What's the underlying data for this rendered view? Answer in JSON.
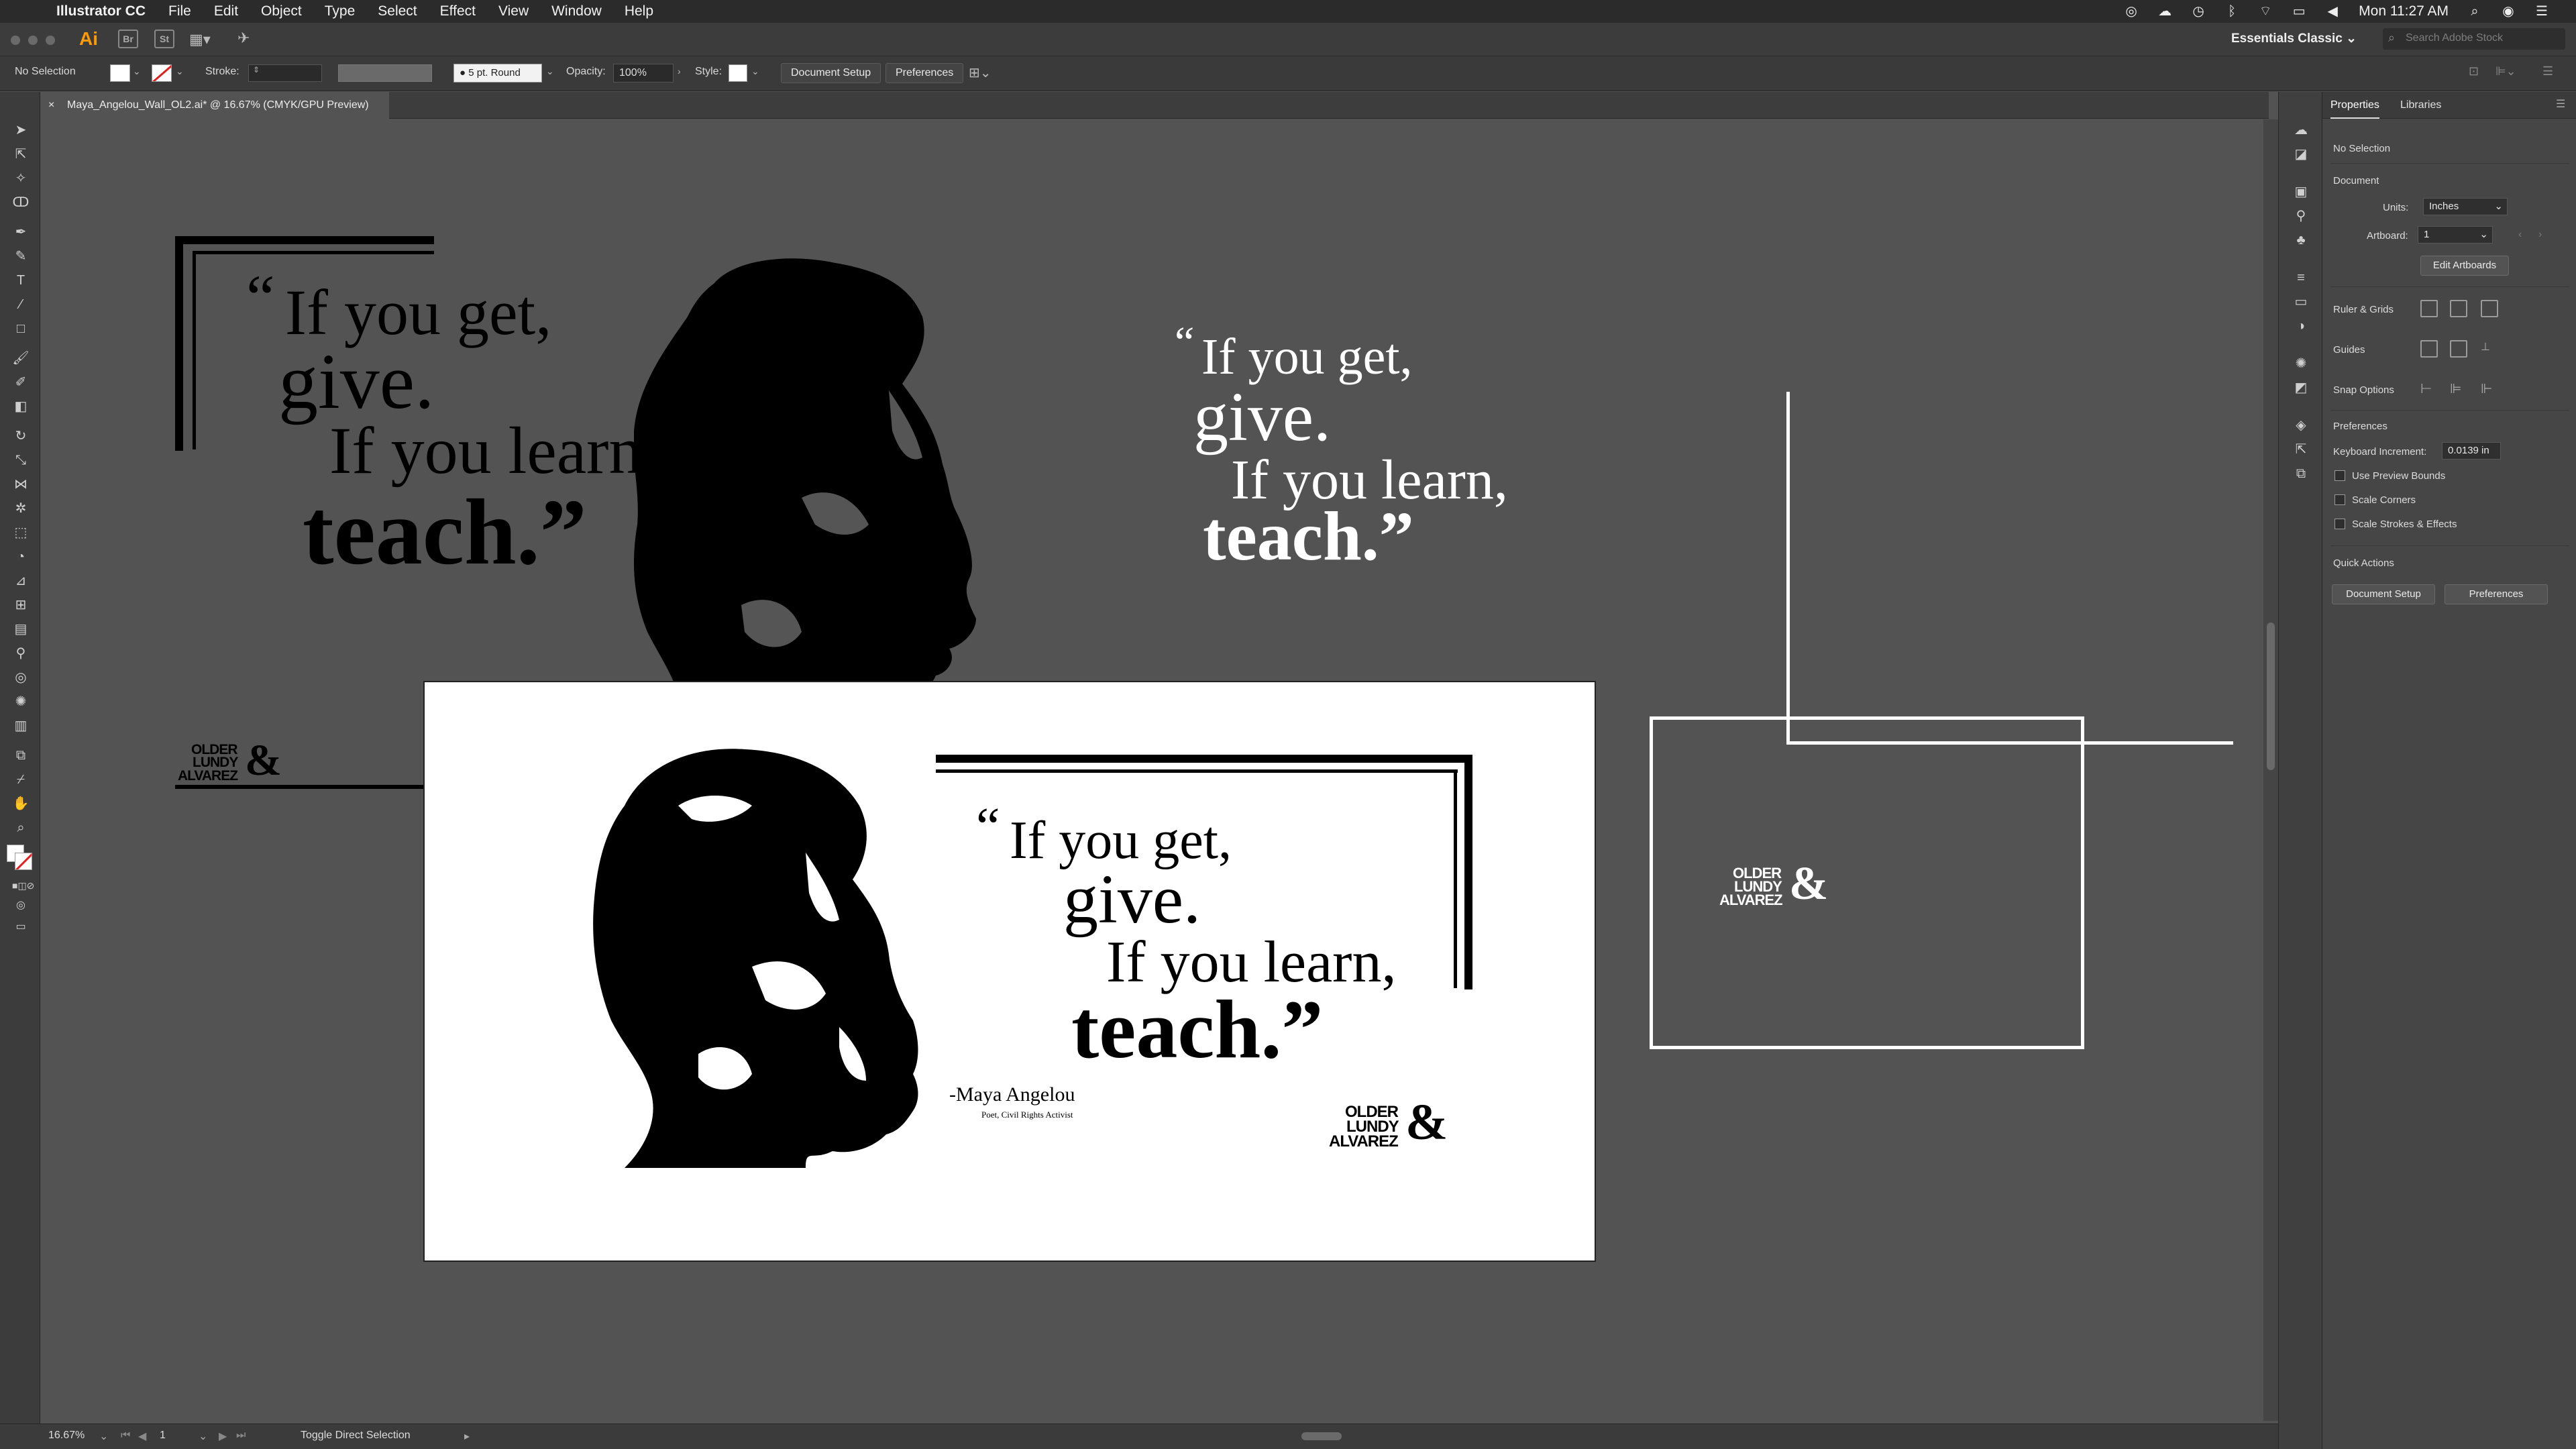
{
  "menubar": {
    "app_name": "Illustrator CC",
    "menus": [
      "File",
      "Edit",
      "Object",
      "Type",
      "Select",
      "Effect",
      "View",
      "Window",
      "Help"
    ],
    "clock": "Mon 11:27 AM"
  },
  "appbar": {
    "ai_logo": "Ai",
    "workspace": "Essentials Classic",
    "search_placeholder": "Search Adobe Stock"
  },
  "controlbar": {
    "selection": "No Selection",
    "stroke_label": "Stroke:",
    "brush": "5 pt. Round",
    "opacity_label": "Opacity:",
    "opacity_value": "100%",
    "style_label": "Style:",
    "document_setup": "Document Setup",
    "preferences": "Preferences"
  },
  "document_tab": {
    "close": "×",
    "title": "Maya_Angelou_Wall_OL2.ai* @ 16.67% (CMYK/GPU Preview)"
  },
  "artwork": {
    "quote_line1": "If you get,",
    "quote_line2": "give.",
    "quote_line3": "If you learn,",
    "quote_line4": "teach.”",
    "open_quote": "“",
    "attribution": "-Maya Angelou",
    "attribution_sub": "Poet, Civil Rights Activist",
    "logo_line1": "OLDER",
    "logo_line2": "LUNDY",
    "logo_line3": "ALVAREZ",
    "logo_amp": "&"
  },
  "statusbar": {
    "zoom": "16.67%",
    "artboard": "1",
    "tool_hint": "Toggle Direct Selection"
  },
  "properties": {
    "tab_properties": "Properties",
    "tab_libraries": "Libraries",
    "selection": "No Selection",
    "document_heading": "Document",
    "units_label": "Units:",
    "units_value": "Inches",
    "artboard_label": "Artboard:",
    "artboard_value": "1",
    "edit_artboards": "Edit Artboards",
    "ruler_grids": "Ruler & Grids",
    "guides": "Guides",
    "snap_options": "Snap Options",
    "preferences_heading": "Preferences",
    "keyboard_increment_label": "Keyboard Increment:",
    "keyboard_increment_value": "0.0139 in",
    "use_preview_bounds": "Use Preview Bounds",
    "scale_corners": "Scale Corners",
    "scale_strokes": "Scale Strokes & Effects",
    "quick_actions": "Quick Actions",
    "qa_document_setup": "Document Setup",
    "qa_preferences": "Preferences"
  }
}
